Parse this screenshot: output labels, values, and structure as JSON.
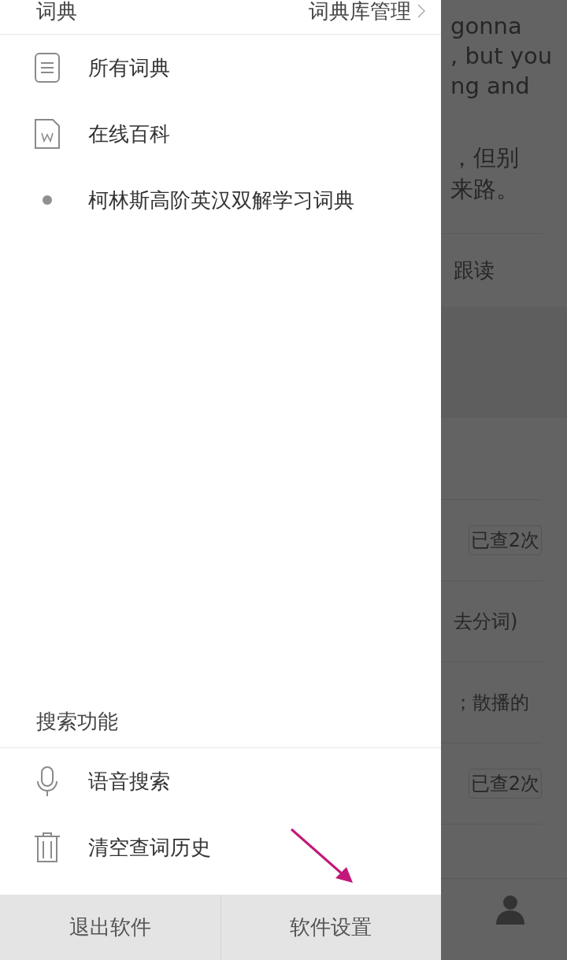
{
  "drawer": {
    "header": {
      "title": "词典",
      "action": "词典库管理"
    },
    "dictionaries": [
      {
        "kind": "list",
        "label": "所有词典"
      },
      {
        "kind": "wiki",
        "label": "在线百科"
      },
      {
        "kind": "dot",
        "label": "柯林斯高阶英汉双解学习词典"
      }
    ],
    "search_section": {
      "title": "搜索功能",
      "items": [
        {
          "kind": "mic",
          "label": "语音搜索"
        },
        {
          "kind": "trash",
          "label": "清空查词历史"
        }
      ]
    },
    "footer": [
      "退出软件",
      "软件设置"
    ]
  },
  "background": {
    "sentence_lines": [
      "gonna",
      ", but you",
      "ng and"
    ],
    "translation_lines": [
      "，但别",
      "来路。"
    ],
    "follow_read": "跟读",
    "rows": [
      {
        "kind": "badge",
        "text": "已查2次"
      },
      {
        "kind": "text",
        "text": "去分词)"
      },
      {
        "kind": "text",
        "text": "；散播的"
      },
      {
        "kind": "badge",
        "text": "已查2次"
      }
    ]
  }
}
